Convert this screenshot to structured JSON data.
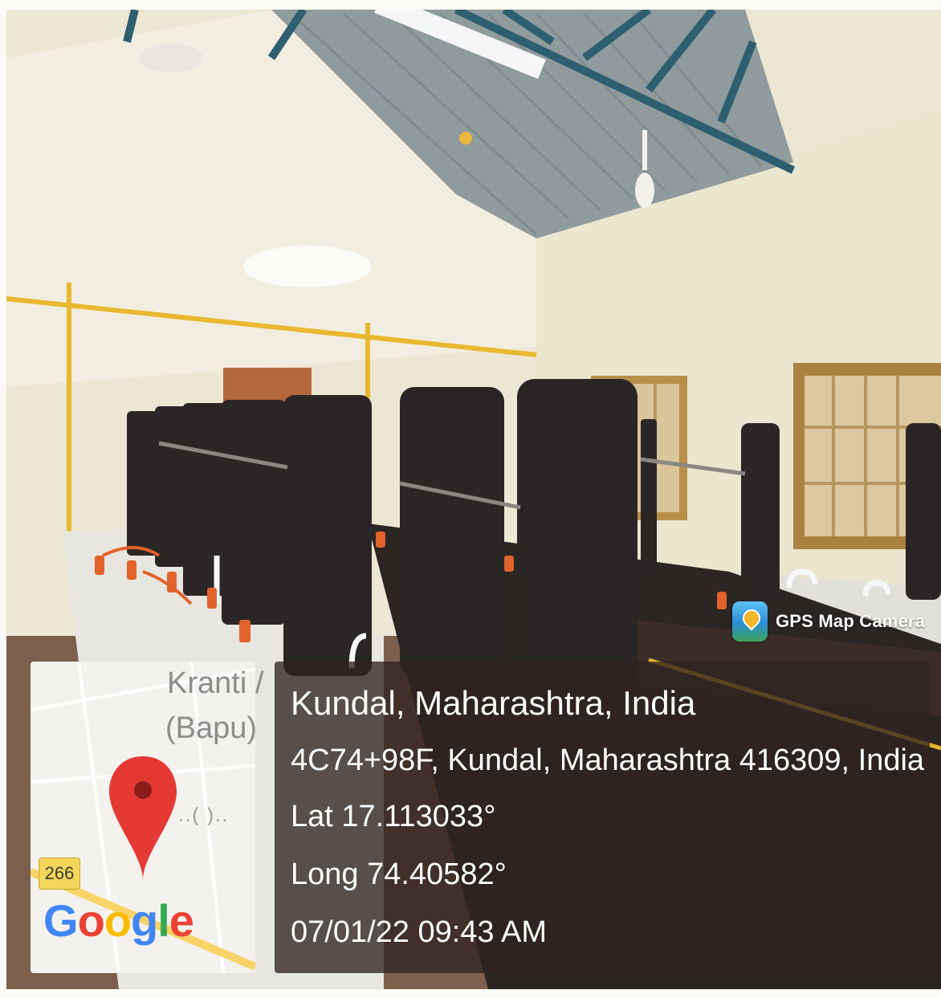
{
  "overlay": {
    "app_name": "GPS Map Camera",
    "app_icon": "gps-map-camera-icon",
    "map": {
      "place_label_1": "Kranti /",
      "place_label_2": "(Bapu)",
      "place_label_3": "..(   )..",
      "road_number": "266",
      "logo_text": "Google",
      "pin_icon": "map-pin-icon",
      "logo_colors": [
        "#4285F4",
        "#EA4335",
        "#FBBC05",
        "#4285F4",
        "#34A853",
        "#EA4335"
      ]
    },
    "info": {
      "place": "Kundal, Maharashtra, India",
      "address": "4C74+98F, Kundal, Maharashtra 416309, India",
      "latitude": "Lat 17.113033°",
      "longitude": "Long 74.40582°",
      "datetime": "07/01/22 09:43 AM"
    }
  },
  "colors": {
    "wall": "#ece8d6",
    "roof": "#8e9a9a",
    "truss": "#2f5e6e",
    "gas_pipe": "#e8b830",
    "bench_dark": "#2b2626",
    "bench_top": "#e6e4de",
    "window_frame": "#b88f4a",
    "info_panel": "#302320",
    "map_pin": "#e53935"
  }
}
